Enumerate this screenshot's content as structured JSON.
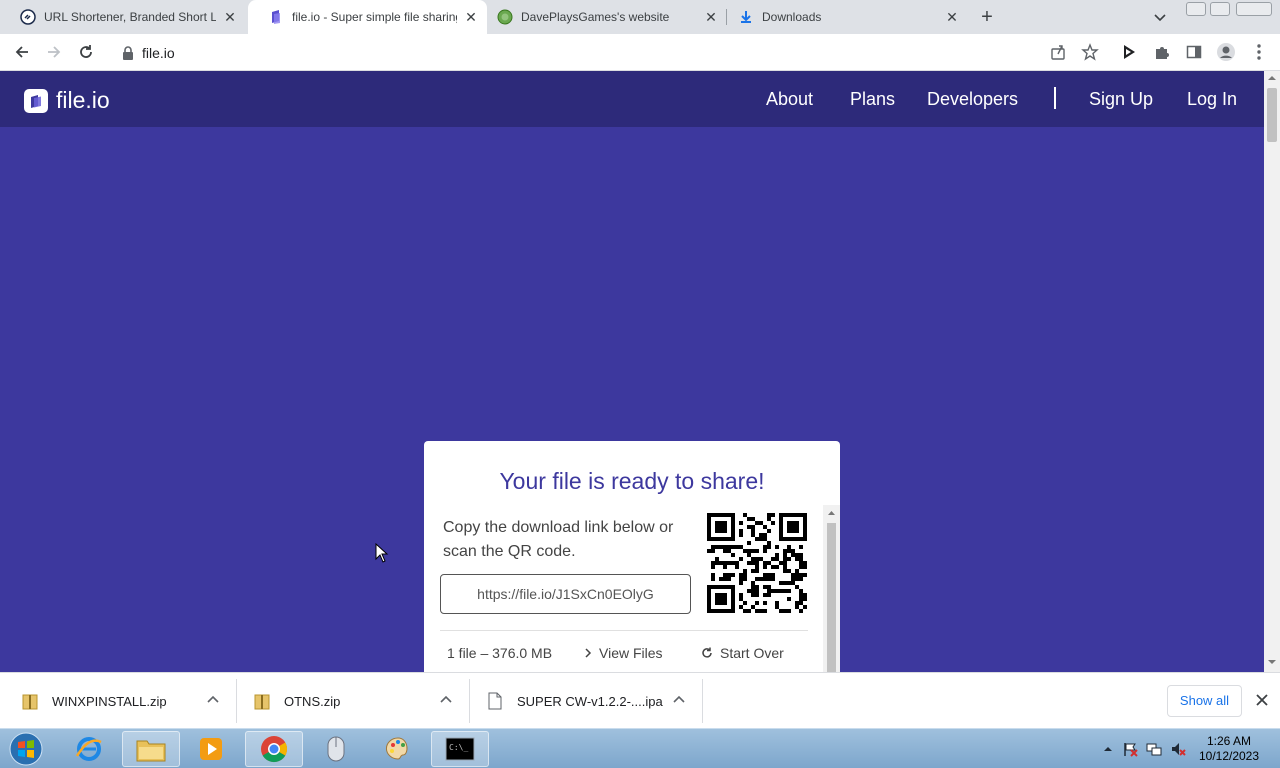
{
  "browser": {
    "tabs": [
      {
        "title": "URL Shortener, Branded Short Links & Analytics | TinyURL",
        "favicon": "tinyurl-icon",
        "active": false
      },
      {
        "title": "file.io - Super simple file sharing",
        "favicon": "fileio-icon",
        "active": true
      },
      {
        "title": "DavePlaysGames's website",
        "favicon": "globe-icon",
        "active": false
      },
      {
        "title": "Downloads",
        "favicon": "download-icon",
        "active": false
      }
    ],
    "url": "file.io"
  },
  "site": {
    "brand": "file.io",
    "nav": {
      "about": "About",
      "plans": "Plans",
      "developers": "Developers",
      "signup": "Sign Up",
      "login": "Log In"
    },
    "colors": {
      "navbar": "#2d2a7a",
      "background": "#3d389e",
      "accent": "#3d389e"
    }
  },
  "card": {
    "title": "Your file is ready to share!",
    "instructions": "Copy the download link below or scan the QR code.",
    "link": "https://file.io/J1SxCn0EOlyG",
    "meta": "1 file – 376.0 MB",
    "view_files": "View Files",
    "start_over": "Start Over"
  },
  "downloads": {
    "items": [
      {
        "name": "WINXPINSTALL.zip",
        "icon": "zip-folder-icon"
      },
      {
        "name": "OTNS.zip",
        "icon": "zip-folder-icon"
      },
      {
        "name": "SUPER CW-v1.2.2-....ipa",
        "icon": "file-icon"
      }
    ],
    "show_all": "Show all"
  },
  "taskbar": {
    "time": "1:26 AM",
    "date": "10/12/2023"
  }
}
